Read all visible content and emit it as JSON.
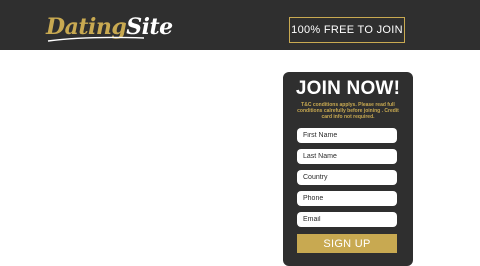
{
  "header": {
    "logo": {
      "part1": "Dating",
      "part2": "Site"
    },
    "free_button_label": "100% FREE TO JOIN"
  },
  "join_form": {
    "title": "JOIN NOW!",
    "note": "T&C conditions applys. Please read full conditions calrefully before joining . Credit card info not required.",
    "fields": {
      "first_name": {
        "placeholder": "First Name",
        "value": ""
      },
      "last_name": {
        "placeholder": "Last Name",
        "value": ""
      },
      "country": {
        "placeholder": "Country",
        "value": ""
      },
      "phone": {
        "placeholder": "Phone",
        "value": ""
      },
      "email": {
        "placeholder": "Email",
        "value": ""
      }
    },
    "submit_label": "SIGN UP"
  },
  "colors": {
    "dark_bg": "#2f2f2f",
    "accent_gold": "#c8a951",
    "page_bg": "#ffffff"
  }
}
